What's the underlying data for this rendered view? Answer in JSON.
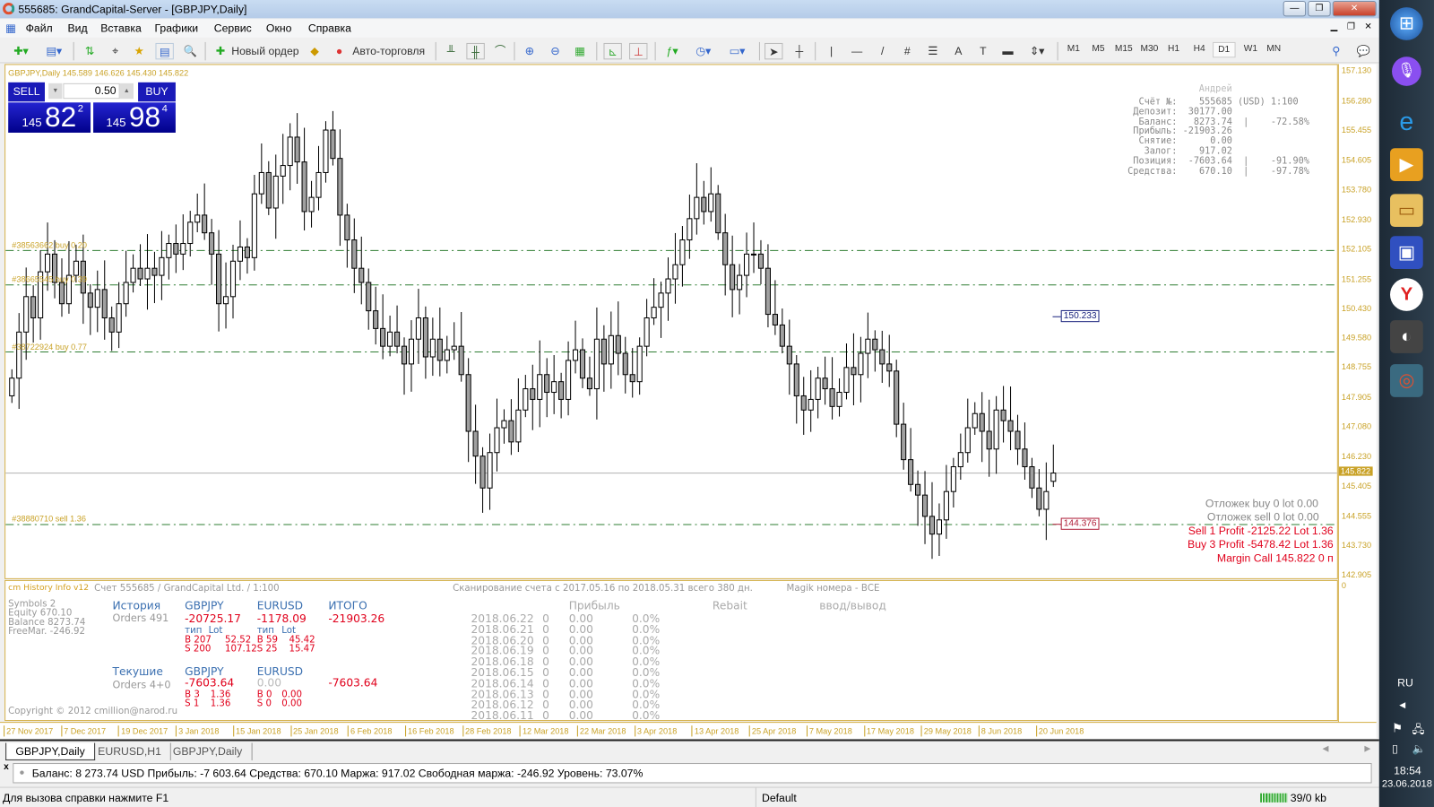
{
  "window": {
    "title": "555685: GrandCapital-Server - [GBPJPY,Daily]",
    "min": "—",
    "max": "❐",
    "close": "✕"
  },
  "menu": [
    "Файл",
    "Вид",
    "Вставка",
    "Графики",
    "Сервис",
    "Окно",
    "Справка"
  ],
  "toolbar": {
    "new_order": "Новый ордер",
    "auto_trading": "Авто-торговля",
    "timeframes": [
      "M1",
      "M5",
      "M15",
      "M30",
      "H1",
      "H4",
      "D1",
      "W1",
      "MN"
    ],
    "active_timeframe": "D1"
  },
  "chart_header": "GBPJPY,Daily  145.589 146.626 145.430 145.822",
  "one_click": {
    "sell": "SELL",
    "buy": "BUY",
    "lot": "0.50",
    "bid_big": "145",
    "bid_main": "82",
    "bid_sup": "2",
    "ask_big": "145",
    "ask_main": "98",
    "ask_sup": "4"
  },
  "account_panel": {
    "name": "Андрей",
    "rows": [
      "  Счёт №:    555685 (USD) 1:100",
      " Депозит:  30177.00",
      "  Баланс:   8273.74  |    -72.58%",
      " Прибыль: -21903.26",
      "  Снятие:      0.00",
      "   Залог:    917.02",
      " Позиция:  -7603.64  |    -91.90%",
      "Средства:    670.10  |    -97.78%"
    ]
  },
  "order_lines": [
    {
      "label": "#38563662 buy 0.20",
      "price": 152.1
    },
    {
      "label": "#38665545 buy 0.39",
      "price": 151.13
    },
    {
      "label": "#38722924 buy 0.77",
      "price": 149.24
    },
    {
      "label": "#38880710 sell 1.36",
      "price": 144.37
    }
  ],
  "price_boxes": [
    {
      "label": "150.233",
      "price": 150.233,
      "color": "#1a237e"
    },
    {
      "label": "144.376",
      "price": 144.376,
      "color": "#b0203a"
    }
  ],
  "pending": {
    "buy": "Отложек buy 0   lot 0.00",
    "sell": "Отложек sell 0   lot 0.00"
  },
  "positions": [
    "Sell 1  Profit -2125.22  Lot 1.36",
    "Buy 3  Profit -5478.42  Lot 1.36",
    "Margin Call 145.822    0 п"
  ],
  "chart_data": {
    "type": "candlestick",
    "symbol": "GBPJPY",
    "timeframe": "Daily",
    "ylim": [
      142.905,
      157.13
    ],
    "yticks": [
      "157.130",
      "156.280",
      "155.455",
      "154.605",
      "153.780",
      "152.930",
      "152.105",
      "151.255",
      "150.430",
      "149.580",
      "148.755",
      "147.905",
      "147.080",
      "146.230",
      "145.405",
      "144.555",
      "143.730",
      "142.905"
    ],
    "current_price": "145.822",
    "xticks": [
      "27 Nov 2017",
      "7 Dec 2017",
      "19 Dec 2017",
      "3 Jan 2018",
      "15 Jan 2018",
      "25 Jan 2018",
      "6 Feb 2018",
      "16 Feb 2018",
      "28 Feb 2018",
      "12 Mar 2018",
      "22 Mar 2018",
      "3 Apr 2018",
      "13 Apr 2018",
      "25 Apr 2018",
      "7 May 2018",
      "17 May 2018",
      "29 May 2018",
      "8 Jun 2018",
      "20 Jun 2018"
    ],
    "first_open": 148.0,
    "close": [
      148.5,
      149.8,
      150.8,
      150.2,
      151.5,
      152.0,
      151.2,
      150.6,
      151.4,
      151.8,
      150.9,
      150.5,
      151.0,
      150.2,
      149.8,
      150.6,
      151.2,
      151.6,
      151.3,
      151.6,
      151.4,
      151.9,
      152.3,
      152.0,
      152.3,
      152.9,
      153.1,
      152.6,
      152.0,
      150.6,
      150.8,
      151.8,
      152.2,
      151.9,
      153.7,
      154.3,
      153.3,
      154.2,
      154.5,
      155.3,
      154.6,
      153.2,
      153.6,
      154.3,
      155.5,
      154.7,
      153.1,
      152.4,
      151.6,
      151.2,
      150.4,
      149.9,
      149.4,
      149.8,
      149.4,
      148.9,
      149.6,
      150.2,
      149.1,
      149.6,
      149.0,
      149.3,
      149.4,
      148.6,
      147.0,
      146.3,
      145.4,
      146.4,
      147.1,
      147.3,
      146.7,
      147.6,
      148.2,
      147.9,
      148.6,
      148.1,
      148.4,
      147.9,
      149.0,
      149.3,
      148.5,
      148.2,
      149.6,
      148.9,
      149.7,
      149.2,
      148.6,
      148.4,
      149.4,
      150.2,
      150.5,
      150.9,
      151.3,
      151.7,
      152.4,
      153.0,
      153.6,
      153.2,
      153.7,
      152.6,
      151.7,
      151.0,
      151.4,
      152.0,
      152.0,
      151.6,
      150.3,
      150.0,
      149.4,
      148.9,
      148.0,
      147.6,
      147.9,
      148.5,
      148.2,
      147.7,
      148.1,
      148.8,
      148.6,
      149.2,
      149.6,
      149.3,
      148.9,
      148.7,
      147.2,
      146.2,
      145.5,
      145.2,
      144.6,
      144.1,
      144.5,
      145.3,
      146.0,
      146.4,
      147.1,
      147.5,
      147.0,
      146.5,
      147.6,
      147.3,
      147.0,
      146.5,
      146.0,
      145.4,
      144.8,
      145.3,
      145.822
    ],
    "last_bar": {
      "open": 145.589,
      "high": 146.626,
      "low": 145.43,
      "close": 145.822
    }
  },
  "indicator": {
    "name": "cm History Info v12",
    "account": "Счет 555685 / GrandCapital Ltd. / 1:100",
    "scan": "Сканирование счета с 2017.05.16 по 2018.05.31 всего 380 дн.",
    "magic": "Magik номера - ВСЕ",
    "left": [
      "Symbols  2",
      "Equity    670.10",
      "Balance  8273.74",
      "FreeMar. -246.92"
    ],
    "history": {
      "title": "История",
      "orders": "Orders 491",
      "sym1": "GBPJPY",
      "sym2": "EURUSD",
      "total_h": "ИТОГО",
      "p1": "-20725.17",
      "p2": "-1178.09",
      "total": "-21903.26",
      "type": "тип",
      "lot": "Lot",
      "s1b": "B 207",
      "s1bl": "52.52",
      "s1s": "S 200",
      "s1sl": "107.12",
      "s2b": "B 59",
      "s2bl": "45.42",
      "s2s": "S 25",
      "s2sl": "15.47"
    },
    "current": {
      "title": "Текушие",
      "orders": "Orders 4+0",
      "sym1": "GBPJPY",
      "sym2": "EURUSD",
      "p1": "-7603.64",
      "p2": "0.00",
      "total": "-7603.64",
      "s1b": "B 3",
      "s1bl": "1.36",
      "s1s": "S 1",
      "s1sl": "1.36",
      "s2b": "B 0",
      "s2bl": "0.00",
      "s2s": "S 0",
      "s2sl": "0.00"
    },
    "copyright": "Copyright © 2012 cmillion@narod.ru",
    "cols": {
      "profit": "Прибыль",
      "rebait": "Rebait",
      "io": "ввод/вывод"
    },
    "rows": [
      [
        "2018.06.22",
        "0",
        "0.00",
        "0.0%"
      ],
      [
        "2018.06.21",
        "0",
        "0.00",
        "0.0%"
      ],
      [
        "2018.06.20",
        "0",
        "0.00",
        "0.0%"
      ],
      [
        "2018.06.19",
        "0",
        "0.00",
        "0.0%"
      ],
      [
        "2018.06.18",
        "0",
        "0.00",
        "0.0%"
      ],
      [
        "2018.06.15",
        "0",
        "0.00",
        "0.0%"
      ],
      [
        "2018.06.14",
        "0",
        "0.00",
        "0.0%"
      ],
      [
        "2018.06.13",
        "0",
        "0.00",
        "0.0%"
      ],
      [
        "2018.06.12",
        "0",
        "0.00",
        "0.0%"
      ],
      [
        "2018.06.11",
        "0",
        "0.00",
        "0.0%"
      ]
    ],
    "zero": "0"
  },
  "tabs": [
    "GBPJPY,Daily",
    "EURUSD,H1",
    "GBPJPY,Daily"
  ],
  "terminal": "Баланс: 8 273.74 USD  Прибыль: -7 603.64  Средства: 670.10  Маржа: 917.02  Свободная маржа: -246.92  Уровень: 73.07%",
  "status": {
    "help": "Для вызова справки нажмите F1",
    "profile": "Default",
    "traffic": "39/0 kb"
  },
  "taskbar": {
    "lang": "RU",
    "time": "18:54",
    "date": "23.06.2018"
  },
  "colors": {
    "bull": "#ffffff",
    "bear": "#a0a0a0",
    "order_line": "#2e7d32",
    "axis": "#c9a227",
    "sell_btn": "#1a1ab8"
  }
}
